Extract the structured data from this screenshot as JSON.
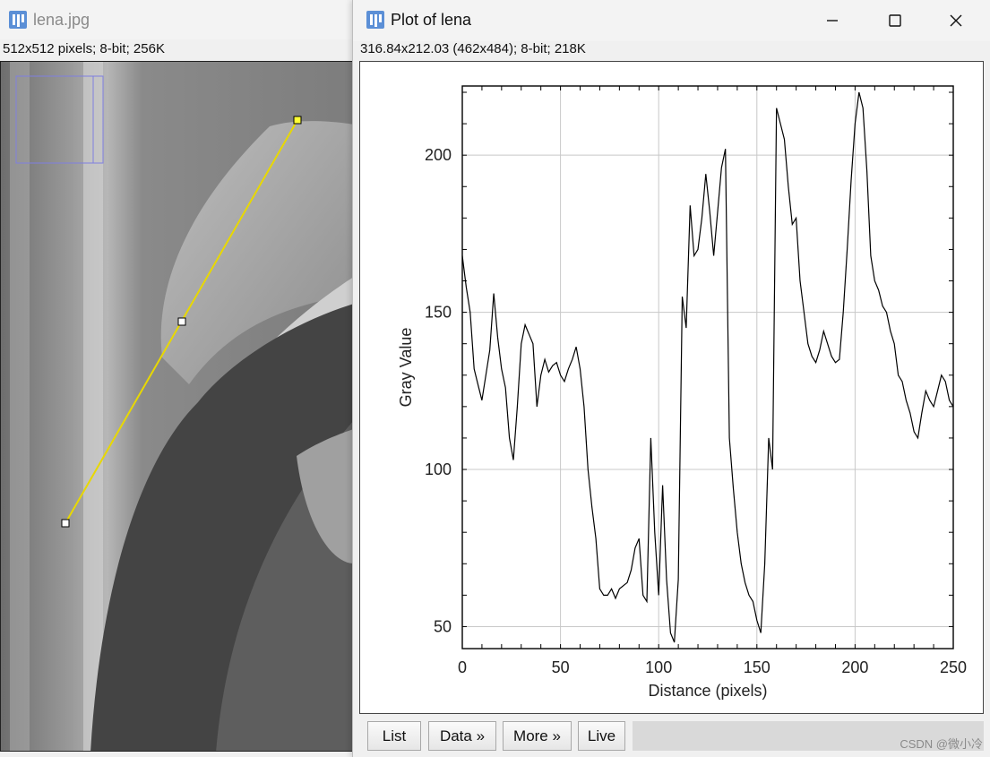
{
  "lena_window": {
    "title": "lena.jpg",
    "info": "512x512 pixels; 8-bit; 256K",
    "line_selection": {
      "start": {
        "x": 72,
        "y": 583
      },
      "end": {
        "x": 331,
        "y": 133
      }
    }
  },
  "plot_window": {
    "title": "Plot of lena",
    "info": "316.84x212.03   (462x484); 8-bit; 218K",
    "controls": {
      "minimize": "minimize-icon",
      "maximize": "maximize-icon",
      "close": "close-icon"
    },
    "buttons": {
      "list": "List",
      "data": "Data »",
      "more": "More »",
      "live": "Live"
    },
    "status": ""
  },
  "watermark": "CSDN @微小冷",
  "colors": {
    "selection_line": "#e8d800",
    "grid": "#c8c8c8",
    "plot_line": "#000000",
    "roi_box": "#7f7fe0"
  },
  "chart_data": {
    "type": "line",
    "xlabel": "Distance (pixels)",
    "ylabel": "Gray Value",
    "xlim": [
      0,
      250
    ],
    "ylim": [
      43,
      222
    ],
    "xticks": [
      0,
      50,
      100,
      150,
      200,
      250
    ],
    "yticks": [
      50,
      100,
      150,
      200
    ],
    "grid": true,
    "x": [
      0,
      2,
      4,
      6,
      8,
      10,
      12,
      14,
      16,
      18,
      20,
      22,
      24,
      26,
      28,
      30,
      32,
      34,
      36,
      38,
      40,
      42,
      44,
      46,
      48,
      50,
      52,
      54,
      56,
      58,
      60,
      62,
      64,
      66,
      68,
      70,
      72,
      74,
      76,
      78,
      80,
      82,
      84,
      86,
      88,
      90,
      92,
      94,
      96,
      98,
      100,
      102,
      104,
      106,
      108,
      110,
      112,
      114,
      116,
      118,
      120,
      122,
      124,
      126,
      128,
      130,
      132,
      134,
      136,
      138,
      140,
      142,
      144,
      146,
      148,
      150,
      152,
      154,
      156,
      158,
      160,
      162,
      164,
      166,
      168,
      170,
      172,
      174,
      176,
      178,
      180,
      182,
      184,
      186,
      188,
      190,
      192,
      194,
      196,
      198,
      200,
      202,
      204,
      206,
      208,
      210,
      212,
      214,
      216,
      218,
      220,
      222,
      224,
      226,
      228,
      230,
      232,
      234,
      236,
      238,
      240,
      242,
      244,
      246,
      248,
      250
    ],
    "y": [
      168,
      158,
      150,
      132,
      127,
      122,
      130,
      138,
      156,
      142,
      132,
      126,
      110,
      103,
      120,
      140,
      146,
      143,
      140,
      120,
      130,
      135,
      131,
      133,
      134,
      130,
      128,
      132,
      135,
      139,
      132,
      120,
      100,
      88,
      78,
      62,
      60,
      60,
      62,
      59,
      62,
      63,
      64,
      68,
      75,
      78,
      60,
      58,
      110,
      80,
      60,
      95,
      65,
      48,
      45,
      65,
      155,
      145,
      184,
      168,
      170,
      180,
      194,
      182,
      168,
      182,
      196,
      202,
      110,
      94,
      80,
      70,
      64,
      60,
      58,
      52,
      48,
      70,
      110,
      100,
      215,
      210,
      205,
      190,
      178,
      180,
      160,
      150,
      140,
      136,
      134,
      138,
      144,
      140,
      136,
      134,
      135,
      150,
      170,
      192,
      210,
      220,
      215,
      195,
      168,
      160,
      157,
      152,
      150,
      144,
      140,
      130,
      128,
      122,
      118,
      112,
      110,
      118,
      125,
      122,
      120,
      125,
      130,
      128,
      122,
      120
    ]
  }
}
